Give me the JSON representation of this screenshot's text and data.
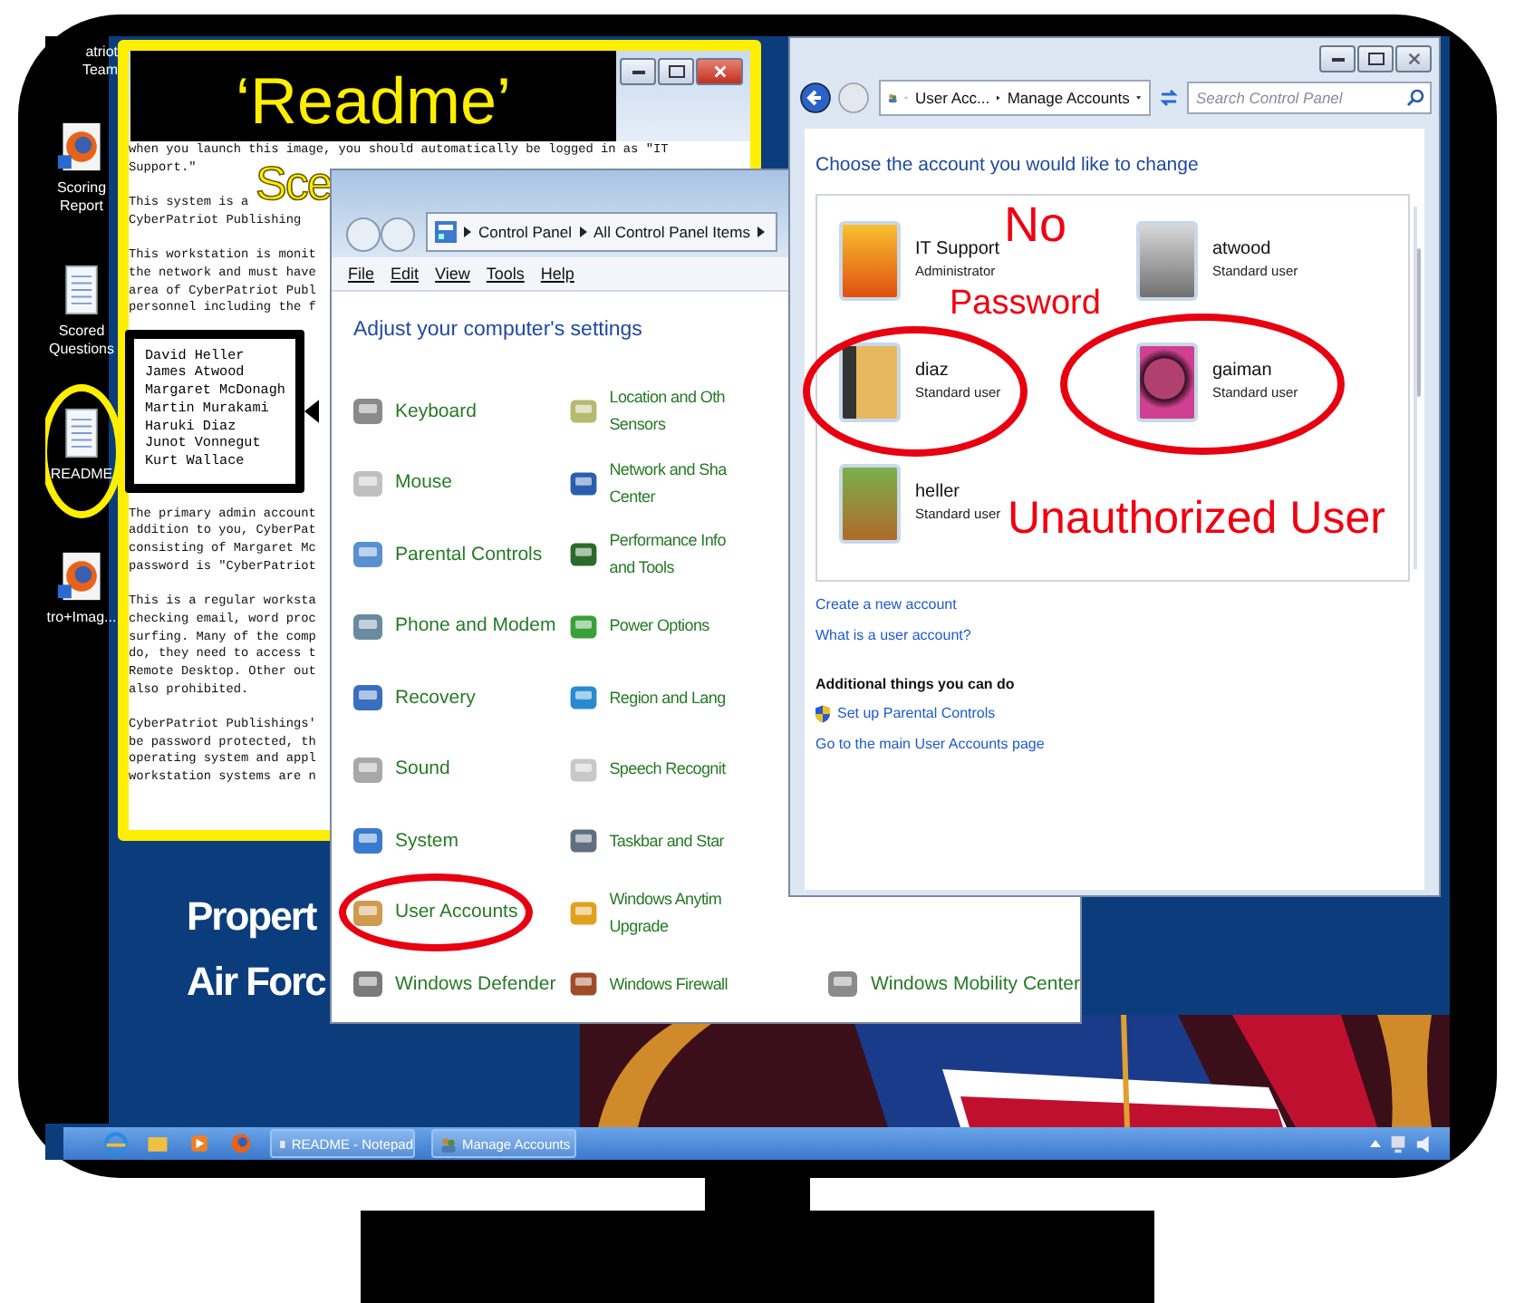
{
  "desktop": {
    "icons": [
      {
        "kind": "none",
        "lines": [
          "atriot",
          "Team"
        ],
        "circled": false
      },
      {
        "kind": "browser",
        "lines": [
          "Scoring",
          "Report"
        ],
        "circled": false
      },
      {
        "kind": "document",
        "lines": [
          "Scored",
          "Questions"
        ],
        "circled": false
      },
      {
        "kind": "document",
        "lines": [
          "README"
        ],
        "circled": true
      },
      {
        "kind": "browser",
        "lines": [
          "tro+Imag..."
        ],
        "circled": false
      }
    ],
    "wallpaper_text": [
      "Propert",
      "Air Forc"
    ]
  },
  "notepad": {
    "callout": "‘Readme’",
    "scenario_fragment": "Sce",
    "paragraphs_top": [
      [
        "when you launch this image, you should automatically be logged in as \"IT",
        "Support.\""
      ],
      [
        "This system is a",
        "CyberPatriot Publishing"
      ],
      [
        "This workstation is monit",
        "the network and must have",
        "area of CyberPatriot Publ",
        "personnel including the f"
      ]
    ],
    "names": [
      "David Heller",
      "James Atwood",
      "Margaret McDonagh",
      "Martin Murakami",
      "Haruki Diaz",
      "Junot Vonnegut",
      "Kurt Wallace"
    ],
    "paragraphs_bottom": [
      [
        "The primary admin account",
        "addition to you, CyberPat",
        "consisting of Margaret Mc",
        "password is \"CyberPatriot"
      ],
      [
        "This is a regular worksta",
        "checking email, word proc",
        "surfing. Many of the comp",
        "do, they need to access t",
        "Remote Desktop. Other out",
        "also prohibited."
      ],
      [
        "CyberPatriot Publishings'",
        "be password protected, th",
        "operating system and appl",
        "workstation systems are n"
      ]
    ]
  },
  "control_panel": {
    "breadcrumb": [
      "Control Panel",
      "All Control Panel Items"
    ],
    "menu": [
      "File",
      "Edit",
      "View",
      "Tools",
      "Help"
    ],
    "heading": "Adjust your computer's settings",
    "columns": [
      [
        {
          "lines": [
            "Keyboard"
          ],
          "circled": false
        },
        {
          "lines": [
            "Mouse"
          ],
          "circled": false
        },
        {
          "lines": [
            "Parental Controls"
          ],
          "circled": false
        },
        {
          "lines": [
            "Phone and Modem"
          ],
          "circled": false
        },
        {
          "lines": [
            "Recovery"
          ],
          "circled": false
        },
        {
          "lines": [
            "Sound"
          ],
          "circled": false
        },
        {
          "lines": [
            "System"
          ],
          "circled": false
        },
        {
          "lines": [
            "User Accounts"
          ],
          "circled": true
        },
        {
          "lines": [
            "Windows Defender"
          ],
          "circled": false
        }
      ],
      [
        {
          "lines": [
            "Location and Oth",
            "Sensors"
          ],
          "circled": false
        },
        {
          "lines": [
            "Network and Sha",
            "Center"
          ],
          "circled": false
        },
        {
          "lines": [
            "Performance Info",
            "and Tools"
          ],
          "circled": false
        },
        {
          "lines": [
            "Power Options"
          ],
          "circled": false
        },
        {
          "lines": [
            "Region and Lang"
          ],
          "circled": false
        },
        {
          "lines": [
            "Speech Recognit"
          ],
          "circled": false
        },
        {
          "lines": [
            "Taskbar and Star"
          ],
          "circled": false
        },
        {
          "lines": [
            "Windows Anytim",
            "Upgrade"
          ],
          "circled": false
        },
        {
          "lines": [
            "Windows Firewall"
          ],
          "circled": false
        }
      ],
      [
        {
          "lines": [
            "Windows Mobility Center"
          ],
          "circled": false
        }
      ]
    ]
  },
  "manage_accounts": {
    "breadcrumb": [
      "User Acc...",
      "Manage Accounts"
    ],
    "search": {
      "placeholder": "Search Control Panel"
    },
    "heading": "Choose the account you would like to change",
    "accounts": [
      {
        "name": "IT Support",
        "type": "Administrator",
        "circled": false
      },
      {
        "name": "atwood",
        "type": "Standard user",
        "circled": false
      },
      {
        "name": "diaz",
        "type": "Standard user",
        "circled": true
      },
      {
        "name": "gaiman",
        "type": "Standard user",
        "circled": true
      },
      {
        "name": "heller",
        "type": "Standard user",
        "circled": false
      }
    ],
    "links": [
      "Create a new account",
      "What is a user account?"
    ],
    "section_title": "Additional things you can do",
    "tasks": [
      {
        "label": "Set up Parental Controls",
        "kind": "shield"
      },
      {
        "label": "Go to the main User Accounts page",
        "kind": "plain"
      }
    ]
  },
  "annotations": {
    "no_password": [
      "No",
      "Password"
    ],
    "unauthorized": "Unauthorized User"
  },
  "taskbar": {
    "buttons": [
      {
        "label": "README - Notepad",
        "kind": "notepad"
      },
      {
        "label": "Manage Accounts",
        "kind": "accounts"
      }
    ]
  }
}
